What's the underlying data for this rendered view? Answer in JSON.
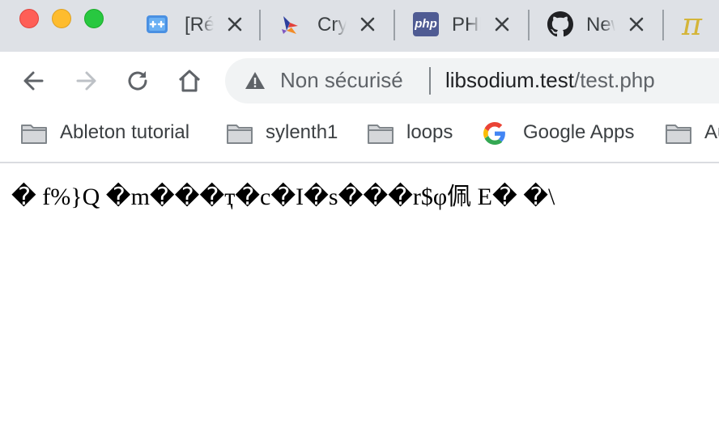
{
  "window": {
    "controls": [
      "close",
      "minimize",
      "maximize"
    ]
  },
  "tabs": [
    {
      "title": "[Ré",
      "icon": "plusplus-icon"
    },
    {
      "title": "Cry",
      "icon": "crystal-bird-icon"
    },
    {
      "title": "PHP",
      "icon": "php-icon",
      "icon_text": "php"
    },
    {
      "title": "New",
      "icon": "github-icon"
    },
    {
      "title": "",
      "icon": "pi-icon",
      "icon_text": "π"
    }
  ],
  "omnibox": {
    "security_label": "Non sécurisé",
    "url_host": "libsodium.test",
    "url_path": "/test.php"
  },
  "bookmarks": [
    {
      "label": "Ableton tutorial",
      "icon": "folder-icon"
    },
    {
      "label": "sylenth1",
      "icon": "folder-icon"
    },
    {
      "label": "loops",
      "icon": "folder-icon"
    },
    {
      "label": "Google Apps",
      "icon": "google-icon"
    },
    {
      "label": "Au",
      "icon": "folder-icon"
    }
  ],
  "page": {
    "body_text": "� f%}Q �m���ҭ�c�I�s���r$φ佩 E� �\\"
  },
  "colors": {
    "tabstrip_bg": "#dee1e6",
    "omnibox_bg": "#f1f3f4",
    "php_icon_bg": "#4f5b93",
    "tab_icon_blue": "#4285f4",
    "pi_color": "#d4b53a"
  }
}
